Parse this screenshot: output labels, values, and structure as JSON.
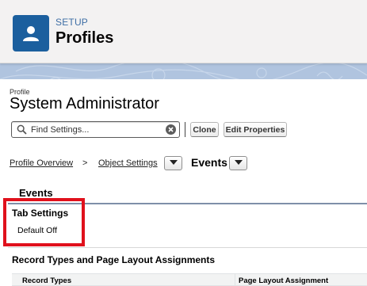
{
  "header": {
    "eyebrow": "SETUP",
    "title": "Profiles",
    "icon": "user-icon"
  },
  "profile": {
    "label": "Profile",
    "name": "System Administrator"
  },
  "toolbar": {
    "search_placeholder": "Find Settings...",
    "clone_label": "Clone",
    "edit_properties_label": "Edit Properties"
  },
  "breadcrumb": {
    "items": [
      "Profile Overview",
      "Object Settings"
    ],
    "separator": ">",
    "current": "Events"
  },
  "section": {
    "title": "Events",
    "tab_settings_title": "Tab Settings",
    "tab_settings_value": "Default Off"
  },
  "record_types": {
    "title": "Record Types and Page Layout Assignments",
    "columns": [
      "Record Types",
      "Page Layout Assignment"
    ]
  },
  "colors": {
    "accent": "#1b5f9e",
    "highlight": "#e0111c",
    "background": "#b0c4df"
  }
}
